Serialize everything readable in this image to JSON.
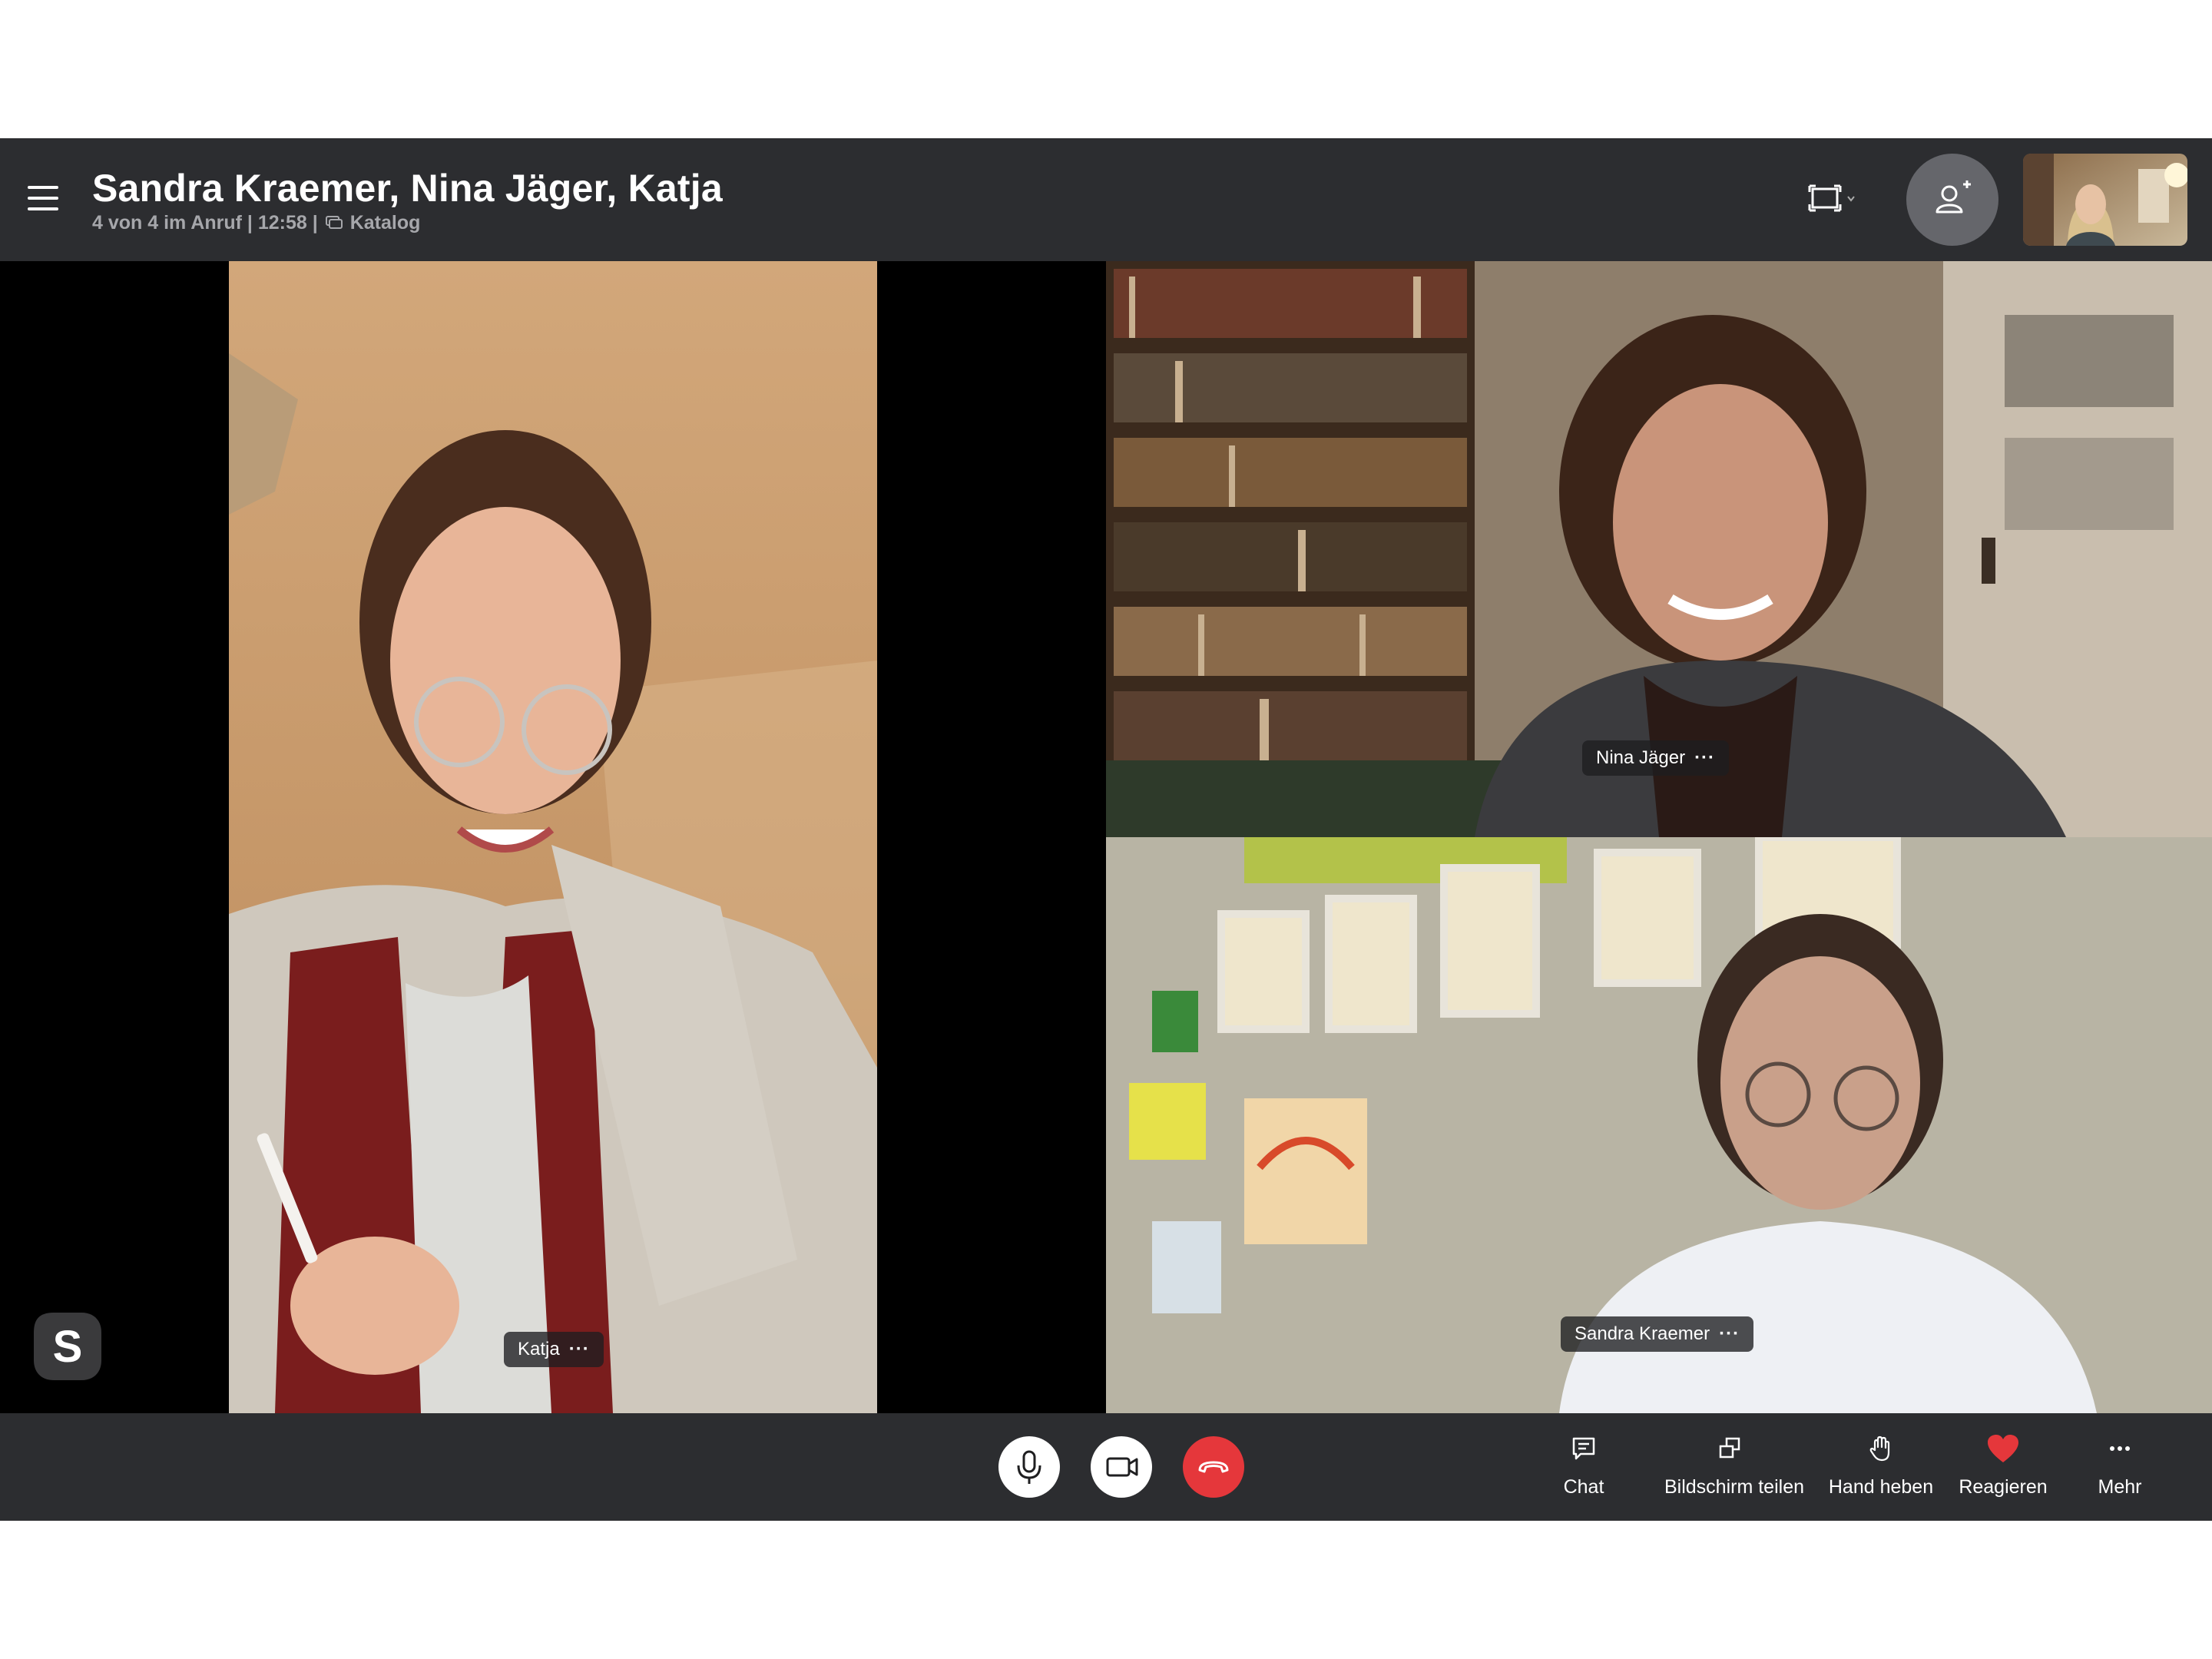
{
  "header": {
    "title": "Sandra Kraemer, Nina Jäger, Katja",
    "call_status": "4 von 4 im Anruf | 12:58 |",
    "group_name": "Katalog",
    "menu_icon": "hamburger-icon",
    "layout_icon": "layout-switch-icon",
    "add_icon": "add-participant-icon"
  },
  "participants": [
    {
      "name": "Katja",
      "more": "···"
    },
    {
      "name": "Nina Jäger",
      "more": "···"
    },
    {
      "name": "Sandra Kraemer",
      "more": "···"
    }
  ],
  "controls": {
    "mic_icon": "microphone-icon",
    "video_icon": "video-camera-icon",
    "hangup_icon": "end-call-icon",
    "tools": [
      {
        "label": "Chat",
        "icon": "chat-icon"
      },
      {
        "label": "Bildschirm teilen",
        "icon": "share-screen-icon"
      },
      {
        "label": "Hand heben",
        "icon": "raise-hand-icon"
      },
      {
        "label": "Reagieren",
        "icon": "heart-icon"
      },
      {
        "label": "Mehr",
        "icon": "more-icon"
      }
    ]
  },
  "colors": {
    "bar": "#2c2d30",
    "hangup": "#e5373b",
    "heart": "#e5373b",
    "subtitle": "#a6a7ab"
  }
}
